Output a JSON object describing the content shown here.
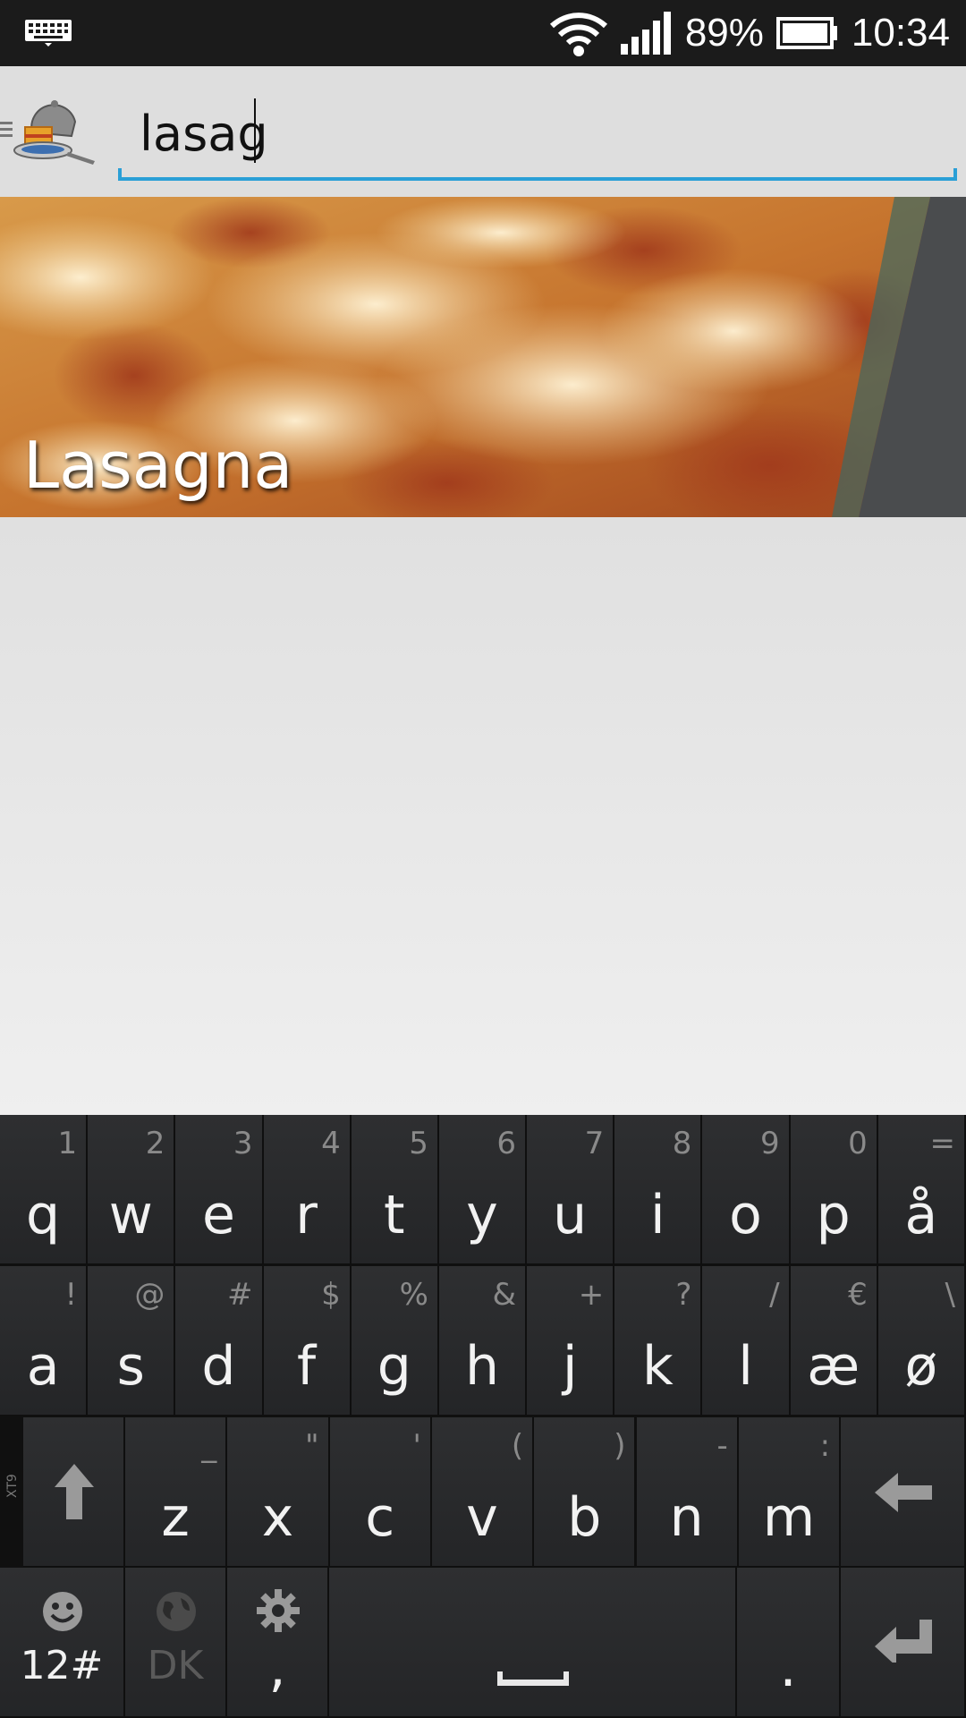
{
  "status_bar": {
    "battery": "89%",
    "time": "10:34",
    "icons": [
      "keyboard-icon",
      "wifi-icon",
      "signal-icon",
      "battery-icon"
    ]
  },
  "action_bar": {
    "search": {
      "value": "lasag"
    },
    "icons": [
      "drawer-icon",
      "app-logo-icon"
    ]
  },
  "results": [
    {
      "title": "Lasagna"
    }
  ],
  "keyboard": {
    "row1": [
      {
        "main": "q",
        "alt": "1"
      },
      {
        "main": "w",
        "alt": "2"
      },
      {
        "main": "e",
        "alt": "3"
      },
      {
        "main": "r",
        "alt": "4"
      },
      {
        "main": "t",
        "alt": "5"
      },
      {
        "main": "y",
        "alt": "6"
      },
      {
        "main": "u",
        "alt": "7"
      },
      {
        "main": "i",
        "alt": "8"
      },
      {
        "main": "o",
        "alt": "9"
      },
      {
        "main": "p",
        "alt": "0"
      },
      {
        "main": "å",
        "alt": "="
      }
    ],
    "row2": [
      {
        "main": "a",
        "alt": "!"
      },
      {
        "main": "s",
        "alt": "@"
      },
      {
        "main": "d",
        "alt": "#"
      },
      {
        "main": "f",
        "alt": "$"
      },
      {
        "main": "g",
        "alt": "%"
      },
      {
        "main": "h",
        "alt": "&"
      },
      {
        "main": "j",
        "alt": "+"
      },
      {
        "main": "k",
        "alt": "?"
      },
      {
        "main": "l",
        "alt": "/"
      },
      {
        "main": "æ",
        "alt": "€"
      },
      {
        "main": "ø",
        "alt": "\\"
      }
    ],
    "row3": [
      {
        "main": "z",
        "alt": "_"
      },
      {
        "main": "x",
        "alt": "\""
      },
      {
        "main": "c",
        "alt": "'"
      },
      {
        "main": "v",
        "alt": "("
      },
      {
        "main": "b",
        "alt": ")"
      },
      {
        "main": "n",
        "alt": "-"
      },
      {
        "main": "m",
        "alt": ":"
      }
    ],
    "row4": {
      "numbers_label": "12#",
      "language_label": "DK",
      "comma_label": ",",
      "period_label": "."
    },
    "side_label": "XT9",
    "icons": [
      "shift-icon",
      "backspace-icon",
      "smiley-icon",
      "globe-icon",
      "settings-icon",
      "space-icon",
      "enter-icon"
    ]
  },
  "colors": {
    "accent": "#2a9fd6",
    "status_bar": "#1b1b1b",
    "keyboard_bg": "#101010",
    "key_bg": "#2a2b2d"
  }
}
